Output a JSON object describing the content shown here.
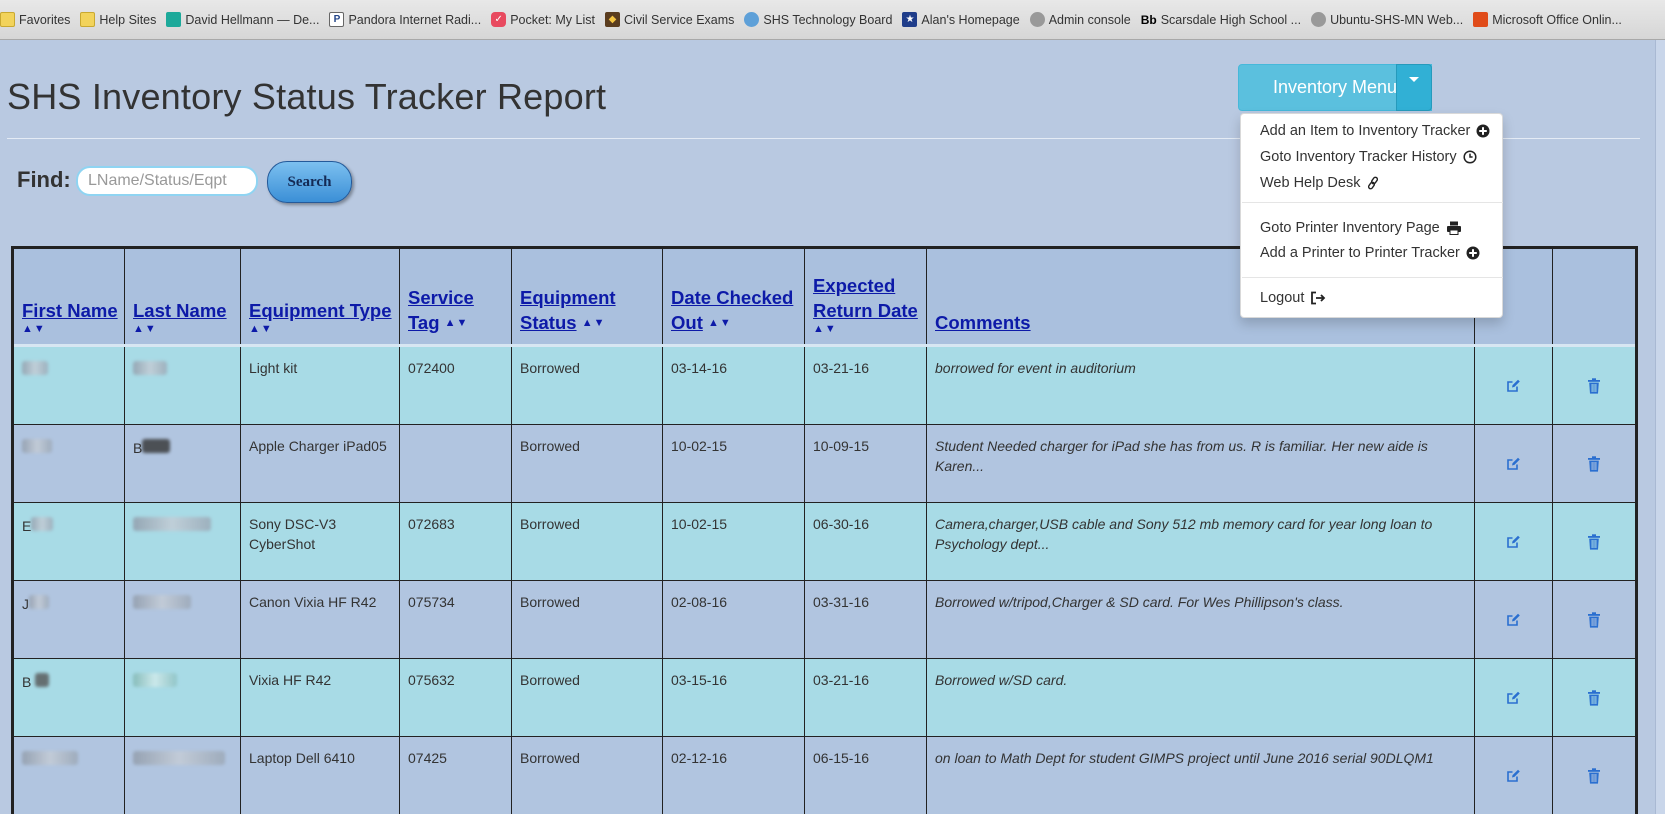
{
  "favorites": [
    {
      "label": "Favorites",
      "icon": "folder-icon"
    },
    {
      "label": "Help Sites",
      "icon": "folder-icon"
    },
    {
      "label": "David Hellmann — De...",
      "icon": "site-icon"
    },
    {
      "label": "Pandora Internet Radi...",
      "icon": "pandora-icon"
    },
    {
      "label": "Pocket: My List",
      "icon": "pocket-icon"
    },
    {
      "label": "Civil Service Exams",
      "icon": "civil-service-icon"
    },
    {
      "label": "SHS Technology Board",
      "icon": "globe-icon"
    },
    {
      "label": "Alan's Homepage",
      "icon": "star-icon"
    },
    {
      "label": "Admin console",
      "icon": "gear-icon"
    },
    {
      "label": "Scarsdale High School ...",
      "icon": "blackboard-icon"
    },
    {
      "label": "Ubuntu-SHS-MN Web...",
      "icon": "gear-icon"
    },
    {
      "label": "Microsoft Office Onlin...",
      "icon": "office-icon"
    }
  ],
  "page": {
    "title": "SHS Inventory Status Tracker Report"
  },
  "find": {
    "label": "Find:",
    "placeholder": "LName/Status/Eqpt",
    "value": "",
    "button": "Search"
  },
  "inventory_menu": {
    "label": "Inventory Menu",
    "items": [
      {
        "label": "Add an Item to Inventory Tracker",
        "icon": "plus-circle-icon"
      },
      {
        "label": "Goto Inventory Tracker History",
        "icon": "clock-icon"
      },
      {
        "label": "Web Help Desk",
        "icon": "link-icon"
      },
      {
        "label": "Goto Printer Inventory Page",
        "icon": "printer-icon"
      },
      {
        "label": "Add a Printer to Printer Tracker",
        "icon": "plus-circle-icon"
      },
      {
        "label": "Logout",
        "icon": "logout-icon"
      }
    ]
  },
  "table": {
    "columns": [
      {
        "line1": "First Name",
        "line2": ""
      },
      {
        "line1": "Last Name",
        "line2": ""
      },
      {
        "line1": "Equipment Type",
        "line2": ""
      },
      {
        "line1": "Service",
        "line2": "Tag"
      },
      {
        "line1": "Equipment",
        "line2": "Status"
      },
      {
        "line1": "Date Checked",
        "line2": "Out"
      },
      {
        "line1": "Expected",
        "line2": "Return Date"
      },
      {
        "line1": "Comments",
        "line2": ""
      }
    ],
    "sort_glyph": "▲▼",
    "rows": [
      {
        "first": "",
        "last": "",
        "equipment": "Light kit",
        "tag": "072400",
        "status": "Borrowed",
        "out": "03-14-16",
        "return": "03-21-16",
        "comments": "borrowed for event in auditorium"
      },
      {
        "first": "",
        "last": "B",
        "equipment": "Apple Charger iPad05",
        "tag": "",
        "status": "Borrowed",
        "out": "10-02-15",
        "return": "10-09-15",
        "comments": "Student Needed charger for iPad she has from us. R        is familiar. Her new aide is Karen..."
      },
      {
        "first": "E",
        "last": "",
        "equipment": "Sony DSC-V3 CyberShot",
        "tag": "072683",
        "status": "Borrowed",
        "out": "10-02-15",
        "return": "06-30-16",
        "comments": "Camera,charger,USB cable and Sony 512 mb memory card for year long loan to Psychology dept..."
      },
      {
        "first": "J",
        "last": "",
        "equipment": "Canon Vixia HF R42",
        "tag": "075734",
        "status": "Borrowed",
        "out": "02-08-16",
        "return": "03-31-16",
        "comments": "Borrowed w/tripod,Charger & SD card. For Wes Phillipson's class."
      },
      {
        "first": "B",
        "last": "",
        "equipment": "Vixia HF R42",
        "tag": "075632",
        "status": "Borrowed",
        "out": "03-15-16",
        "return": "03-21-16",
        "comments": "Borrowed w/SD card."
      },
      {
        "first": "",
        "last": "",
        "equipment": "Laptop Dell 6410",
        "tag": "07425",
        "status": "Borrowed",
        "out": "02-12-16",
        "return": "06-15-16",
        "comments": "on loan to Math Dept for student GIMPS project until June 2016 serial 90DLQM1"
      }
    ]
  },
  "colors": {
    "background": "#b9c9e1",
    "row_cyan": "#a8dbe6",
    "row_lavender": "#b1c5e0",
    "header_link": "#0d1aa8",
    "action_icon": "#2a6fd0",
    "menu_button": "#5bc0de"
  }
}
